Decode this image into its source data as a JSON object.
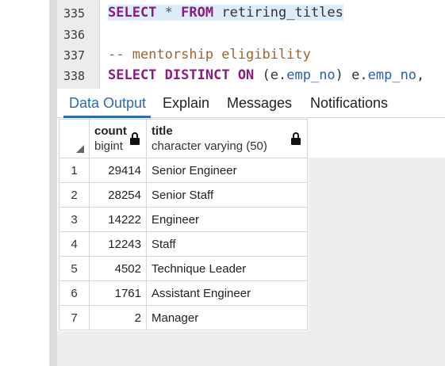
{
  "editor": {
    "lines": [
      {
        "number": "335",
        "tokens": [
          {
            "text": "SELECT",
            "cls": "kw"
          },
          {
            "text": " ",
            "cls": "pl"
          },
          {
            "text": "*",
            "cls": "op"
          },
          {
            "text": " ",
            "cls": "pl"
          },
          {
            "text": "FROM",
            "cls": "kw"
          },
          {
            "text": " retiring_titles",
            "cls": "pl"
          }
        ]
      },
      {
        "number": "336",
        "tokens": []
      },
      {
        "number": "337",
        "tokens": [
          {
            "text": "-- mentorship eligibility",
            "cls": "cm"
          }
        ]
      },
      {
        "number": "338",
        "tokens": [
          {
            "text": "SELECT",
            "cls": "kw"
          },
          {
            "text": " ",
            "cls": "pl"
          },
          {
            "text": "DISTINCT",
            "cls": "kw"
          },
          {
            "text": " ",
            "cls": "pl"
          },
          {
            "text": "ON",
            "cls": "kw"
          },
          {
            "text": " (e.",
            "cls": "pl"
          },
          {
            "text": "emp_no",
            "cls": "fn"
          },
          {
            "text": ") e.",
            "cls": "pl"
          },
          {
            "text": "emp_no",
            "cls": "fn"
          },
          {
            "text": ",",
            "cls": "pl"
          }
        ]
      }
    ]
  },
  "tabs": [
    {
      "label": "Data Output",
      "active": true
    },
    {
      "label": "Explain",
      "active": false
    },
    {
      "label": "Messages",
      "active": false
    },
    {
      "label": "Notifications",
      "active": false
    }
  ],
  "grid": {
    "columns": [
      {
        "name": "count",
        "type": "bigint"
      },
      {
        "name": "title",
        "type": "character varying (50)"
      }
    ],
    "rows": [
      {
        "n": "1",
        "count": "29414",
        "title": "Senior Engineer"
      },
      {
        "n": "2",
        "count": "28254",
        "title": "Senior Staff"
      },
      {
        "n": "3",
        "count": "14222",
        "title": "Engineer"
      },
      {
        "n": "4",
        "count": "12243",
        "title": "Staff"
      },
      {
        "n": "5",
        "count": "4502",
        "title": "Technique Leader"
      },
      {
        "n": "6",
        "count": "1761",
        "title": "Assistant Engineer"
      },
      {
        "n": "7",
        "count": "2",
        "title": "Manager"
      }
    ]
  }
}
